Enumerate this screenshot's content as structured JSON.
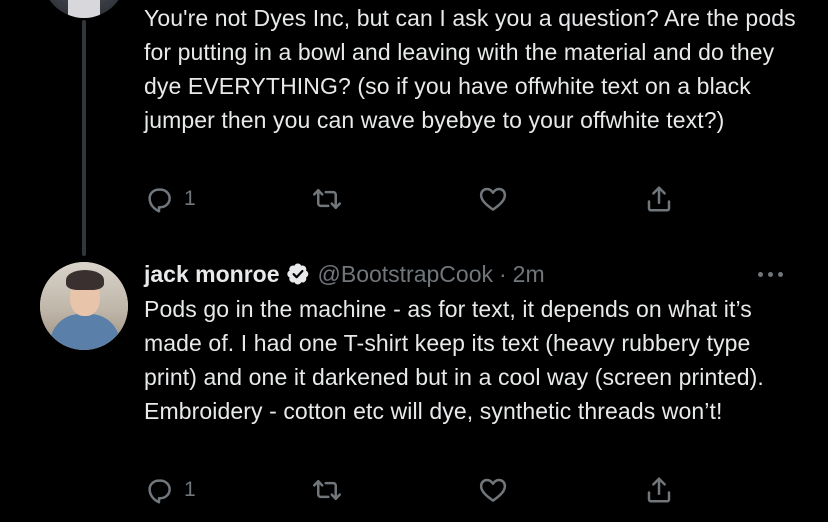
{
  "reply_tweet": {
    "text": "You're not Dyes Inc, but can I ask you a question? Are the pods for putting in a bowl and leaving with the material and do they dye EVERYTHING? (so if you have offwhite text on a black jumper then you can wave byebye to your offwhite text?)",
    "reply_count": "1",
    "retweet_count": "",
    "like_count": ""
  },
  "main_tweet": {
    "display_name": "jack monroe",
    "handle": "@BootstrapCook",
    "separator": "·",
    "time": "2m",
    "text": "Pods go in the machine - as for text, it depends on what it’s made of. I had one T-shirt keep its text (heavy rubbery type print) and one it darkened but in a cool way (screen printed). Embroidery - cotton etc will dye, synthetic threads won’t!",
    "reply_count": "1",
    "retweet_count": "",
    "like_count": ""
  },
  "icons": {
    "reply": "reply-icon",
    "retweet": "retweet-icon",
    "like": "heart-icon",
    "share": "share-icon",
    "verified": "verified-badge-icon",
    "more": "more-options-icon"
  },
  "colors": {
    "background": "#000000",
    "text_primary": "#e7e9ea",
    "text_secondary": "#71767b",
    "thread_line": "#333639"
  }
}
